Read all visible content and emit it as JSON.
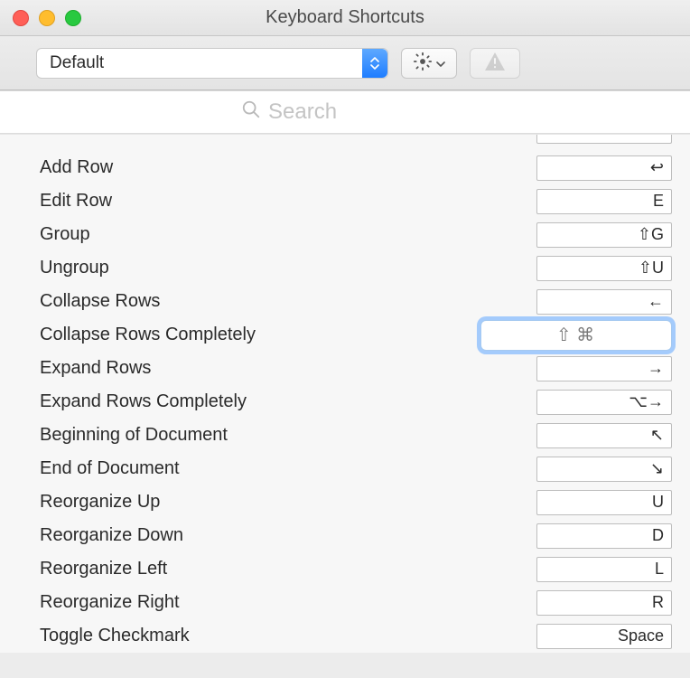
{
  "window": {
    "title": "Keyboard Shortcuts"
  },
  "toolbar": {
    "scheme_selected": "Default",
    "gear_icon": "gear",
    "warn_icon": "warning"
  },
  "search": {
    "placeholder": "Search",
    "value": ""
  },
  "shortcuts": [
    {
      "label": "Add Row",
      "key": "↩",
      "selected": false
    },
    {
      "label": "Edit Row",
      "key": "E",
      "selected": false
    },
    {
      "label": "Group",
      "key": "⇧G",
      "selected": false
    },
    {
      "label": "Ungroup",
      "key": "⇧U",
      "selected": false
    },
    {
      "label": "Collapse Rows",
      "key": "←",
      "selected": false
    },
    {
      "label": "Collapse Rows Completely",
      "key": "⇧ ⌘",
      "selected": true
    },
    {
      "label": "Expand Rows",
      "key": "→",
      "selected": false
    },
    {
      "label": "Expand Rows Completely",
      "key": "⌥→",
      "selected": false
    },
    {
      "label": "Beginning of Document",
      "key": "↖",
      "selected": false
    },
    {
      "label": "End of Document",
      "key": "↘",
      "selected": false
    },
    {
      "label": "Reorganize Up",
      "key": "U",
      "selected": false
    },
    {
      "label": "Reorganize Down",
      "key": "D",
      "selected": false
    },
    {
      "label": "Reorganize Left",
      "key": "L",
      "selected": false
    },
    {
      "label": "Reorganize Right",
      "key": "R",
      "selected": false
    },
    {
      "label": "Toggle Checkmark",
      "key": "Space",
      "selected": false
    }
  ]
}
